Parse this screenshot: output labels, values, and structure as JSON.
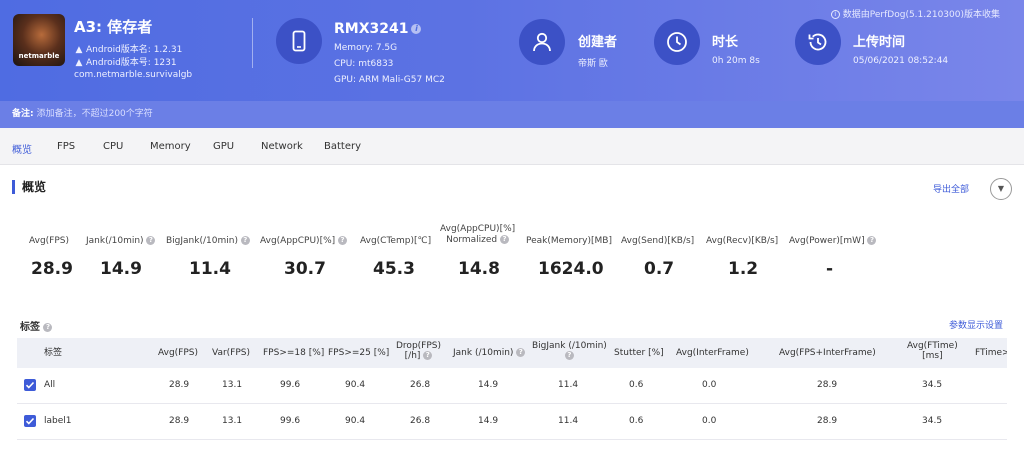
{
  "header": {
    "app": {
      "logo_text": "netmarble",
      "name": "A3: 倖存者",
      "version_name": "Android版本名: 1.2.31",
      "version_code": "Android版本号: 1231",
      "package": "com.netmarble.survivalgb",
      "os_icon": "android-icon"
    },
    "device": {
      "icon": "phone-icon",
      "name": "RMX3241",
      "memory": "Memory: 7.5G",
      "cpu": "CPU: mt6833",
      "gpu": "GPU: ARM Mali-G57 MC2"
    },
    "creator": {
      "icon": "user-icon",
      "label": "创建者",
      "value": "帝斯 歐"
    },
    "duration": {
      "icon": "clock-icon",
      "label": "时长",
      "value": "0h 20m 8s"
    },
    "upload": {
      "icon": "history-icon",
      "label": "上传时间",
      "value": "05/06/2021 08:52:44"
    },
    "source": "数据由PerfDog(5.1.210300)版本收集"
  },
  "note": {
    "label": "备注:",
    "placeholder": "添加备注，不超过200个字符"
  },
  "tabs": [
    {
      "label": "概览",
      "active": true
    },
    {
      "label": "FPS"
    },
    {
      "label": "CPU"
    },
    {
      "label": "Memory"
    },
    {
      "label": "GPU"
    },
    {
      "label": "Network"
    },
    {
      "label": "Battery"
    }
  ],
  "overview": {
    "title": "概览",
    "export_label": "导出全部",
    "metrics": [
      {
        "label": "Avg(FPS)",
        "value": "28.9"
      },
      {
        "label": "Jank(/10min)",
        "value": "14.9",
        "help": true
      },
      {
        "label": "BigJank(/10min)",
        "value": "11.4",
        "help": true
      },
      {
        "label": "Avg(AppCPU)[%]",
        "value": "30.7",
        "help": true
      },
      {
        "label": "Avg(CTemp)[℃]",
        "value": "45.3"
      },
      {
        "label": "Avg(AppCPU)[%]",
        "label2": "Normalized",
        "value": "14.8",
        "help": true
      },
      {
        "label": "Peak(Memory)[MB]",
        "value": "1624.0"
      },
      {
        "label": "Avg(Send)[KB/s]",
        "value": "0.7"
      },
      {
        "label": "Avg(Recv)[KB/s]",
        "value": "1.2"
      },
      {
        "label": "Avg(Power)[mW]",
        "value": "-",
        "help": true
      }
    ]
  },
  "labels_section": {
    "title": "标签",
    "settings_label": "参数显示设置",
    "columns": [
      {
        "line1": "标签"
      },
      {
        "line1": "Avg(FPS)"
      },
      {
        "line1": "Var(FPS)"
      },
      {
        "line1": "FPS>=18 [%]"
      },
      {
        "line1": "FPS>=25 [%]"
      },
      {
        "line1": "Drop(FPS)",
        "line2": "[/h]",
        "help": true
      },
      {
        "line1": "Jank (/10min)",
        "help": true
      },
      {
        "line1": "BigJank (/10min)",
        "help": true
      },
      {
        "line1": "Stutter [%]"
      },
      {
        "line1": "Avg(InterFrame)"
      },
      {
        "line1": "Avg(FPS+InterFrame)"
      },
      {
        "line1": "Avg(FTime)",
        "line2": "[ms]"
      },
      {
        "line1": "FTime>"
      }
    ],
    "rows": [
      {
        "label": "All",
        "checked": true,
        "cells": [
          "28.9",
          "13.1",
          "99.6",
          "90.4",
          "26.8",
          "14.9",
          "11.4",
          "0.6",
          "0.0",
          "28.9",
          "34.5"
        ]
      },
      {
        "label": "label1",
        "checked": true,
        "cells": [
          "28.9",
          "13.1",
          "99.6",
          "90.4",
          "26.8",
          "14.9",
          "11.4",
          "0.6",
          "0.0",
          "28.9",
          "34.5"
        ]
      }
    ]
  }
}
